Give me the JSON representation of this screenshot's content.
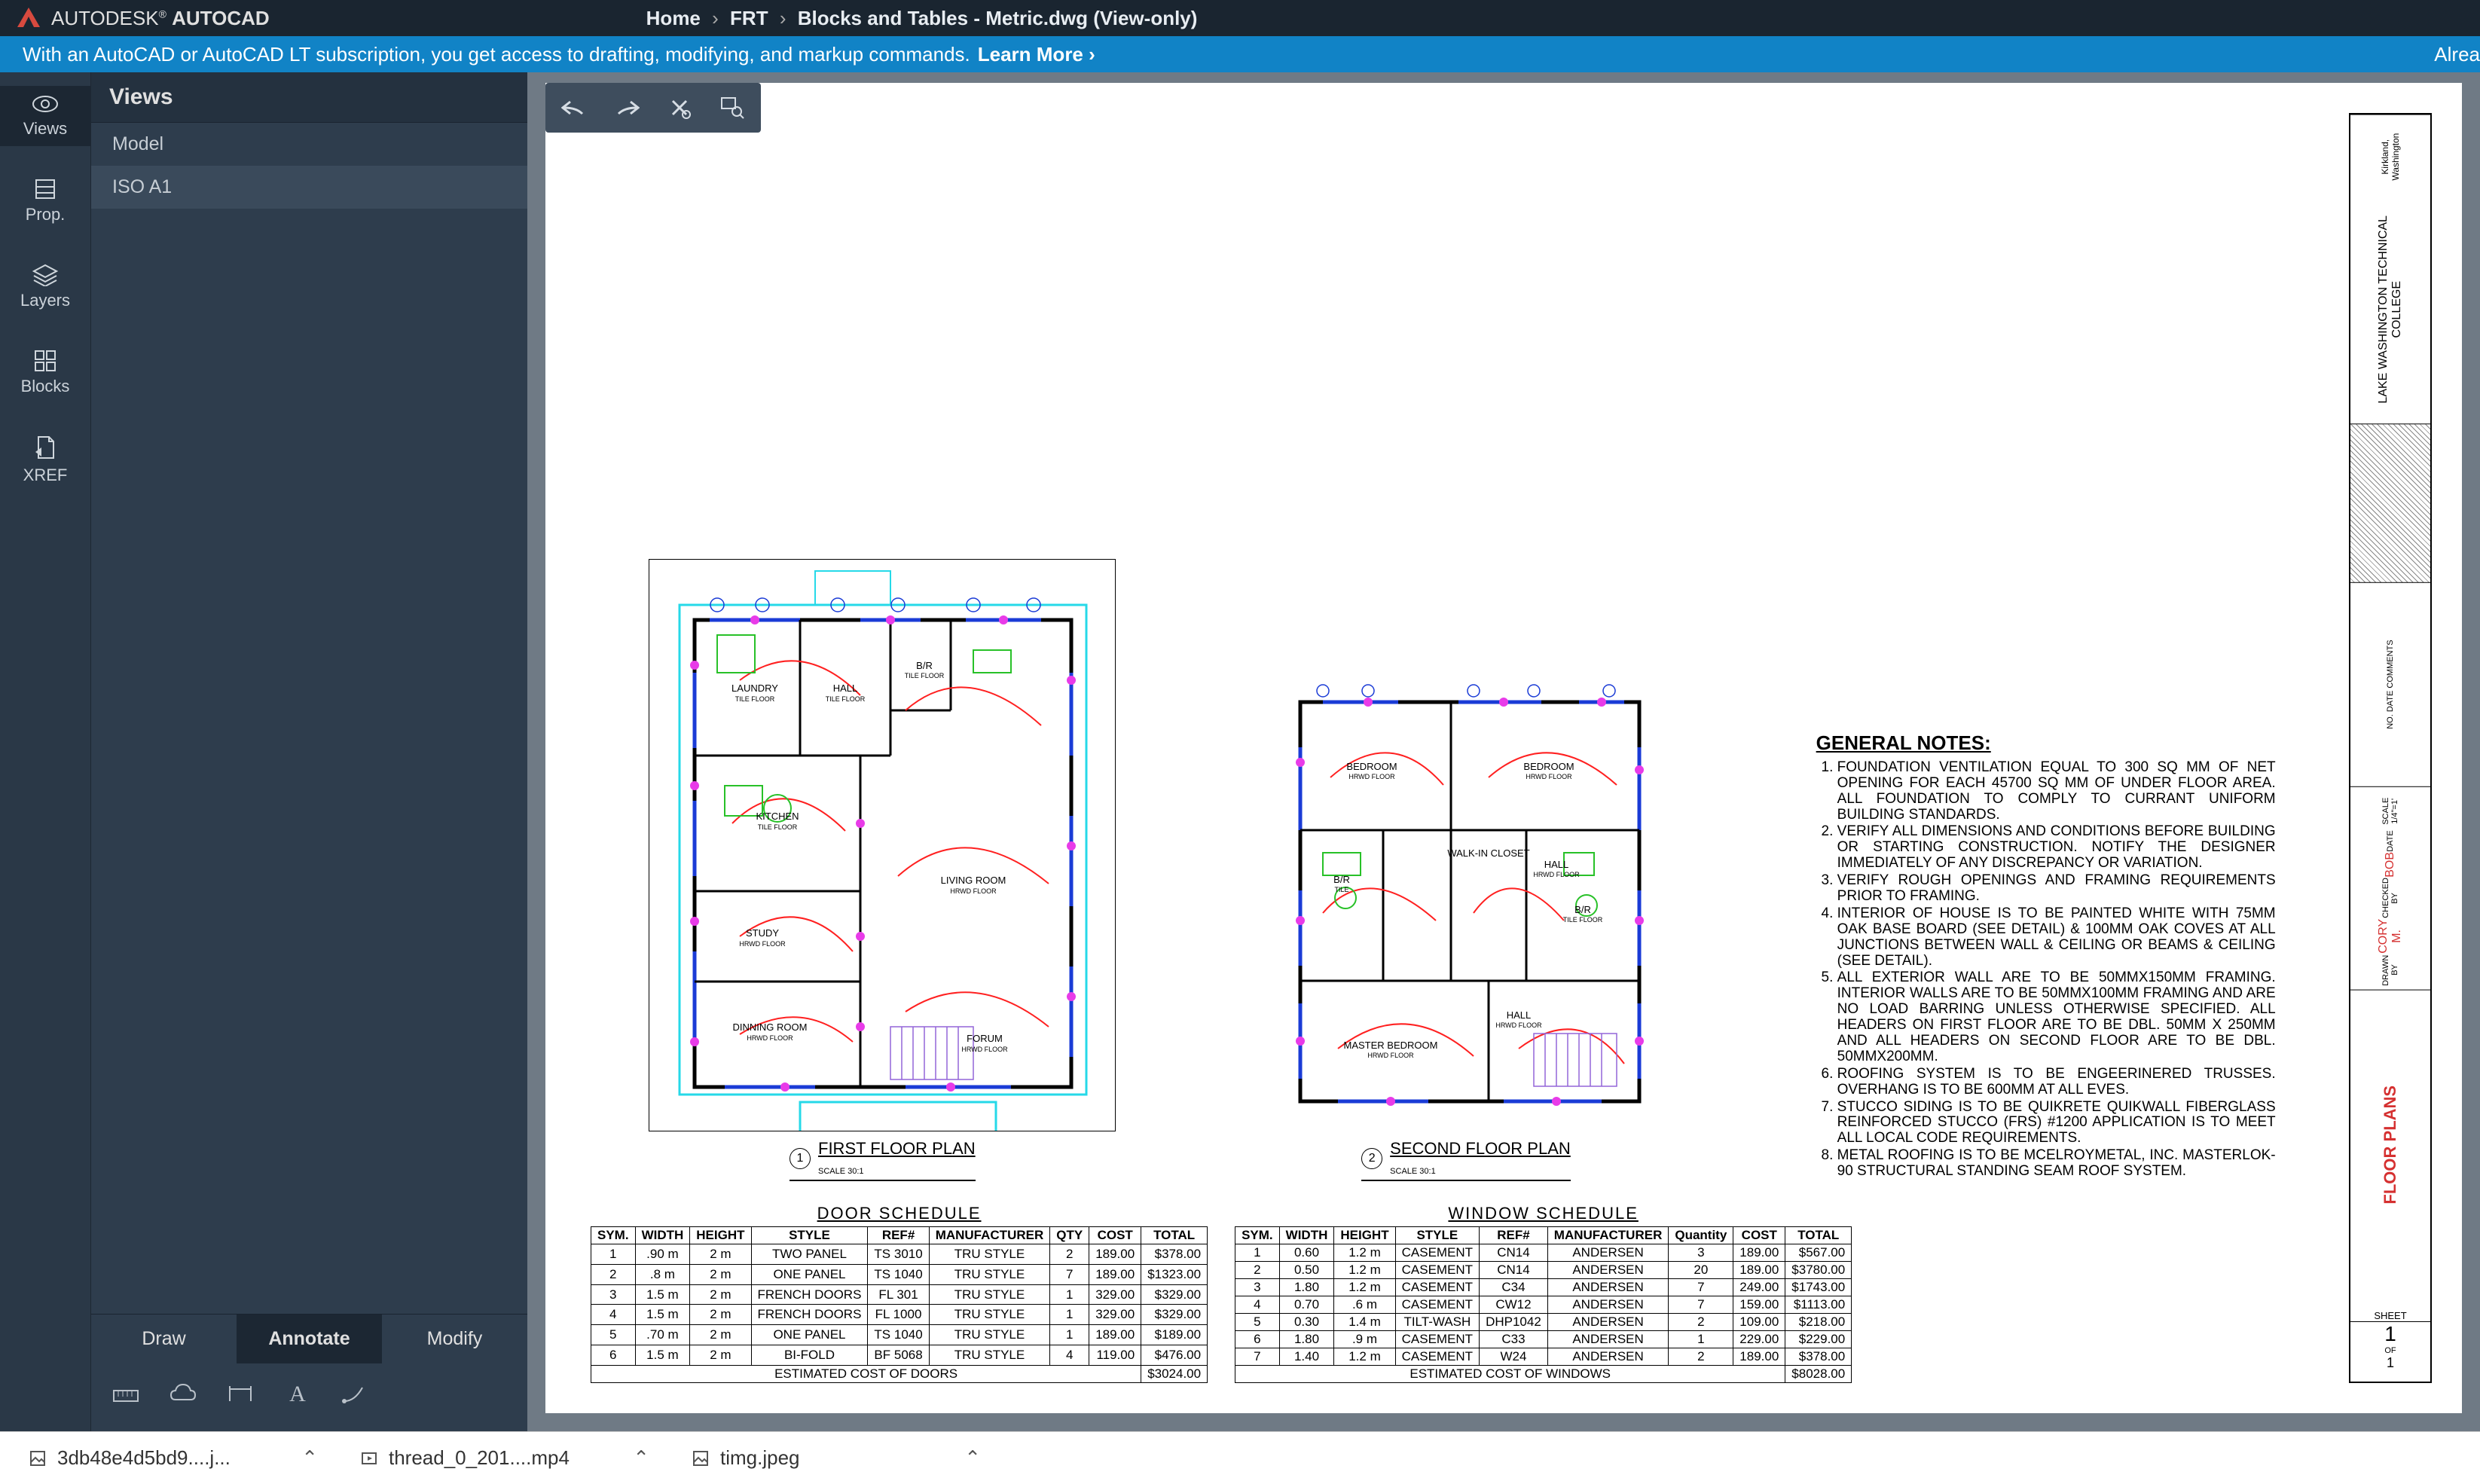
{
  "app": {
    "brand_a": "AUTODESK",
    "brand_b": "AUTOCAD",
    "breadcrumb": [
      "Home",
      "FRT",
      "Blocks and Tables - Metric.dwg (View-only)"
    ]
  },
  "announcement": {
    "text": "With an AutoCAD or AutoCAD LT subscription, you get access to drafting, modifying, and markup commands.",
    "link": "Learn More ›",
    "already": "Alrea"
  },
  "rail": [
    {
      "label": "Views",
      "active": true
    },
    {
      "label": "Prop.",
      "active": false
    },
    {
      "label": "Layers",
      "active": false
    },
    {
      "label": "Blocks",
      "active": false
    },
    {
      "label": "XREF",
      "active": false
    }
  ],
  "panel": {
    "title": "Views",
    "items": [
      "Model",
      "ISO A1"
    ],
    "selected": 1
  },
  "tool_tabs": [
    {
      "label": "Draw",
      "active": false
    },
    {
      "label": "Annotate",
      "active": true
    },
    {
      "label": "Modify",
      "active": false
    }
  ],
  "floor1": {
    "title": "FIRST FLOOR PLAN",
    "scale": "SCALE 30:1",
    "num": "1",
    "rooms": [
      "LAUNDRY",
      "HALL",
      "B/R",
      "KITCHEN",
      "LIVING ROOM",
      "STUDY",
      "DINNING ROOM",
      "FORUM"
    ],
    "floor": "HRWD FLOOR",
    "tile": "TILE FLOOR"
  },
  "floor2": {
    "title": "SECOND FLOOR PLAN",
    "scale": "SCALE 30:1",
    "num": "2",
    "rooms": [
      "BEDROOM",
      "BEDROOM",
      "WALK-IN CLOSET",
      "HALL",
      "B/R",
      "B/R",
      "MASTER BEDROOM",
      "HALL"
    ],
    "floor": "HRWD FLOOR"
  },
  "notes": {
    "title": "GENERAL NOTES:",
    "items": [
      "FOUNDATION VENTILATION EQUAL TO 300 SQ MM OF NET OPENING FOR EACH 45700 SQ MM OF UNDER FLOOR AREA. ALL FOUNDATION TO COMPLY TO CURRANT UNIFORM BUILDING STANDARDS.",
      "VERIFY ALL DIMENSIONS AND CONDITIONS BEFORE BUILDING OR STARTING CONSTRUCTION. NOTIFY THE DESIGNER IMMEDIATELY OF ANY DISCREPANCY OR VARIATION.",
      "VERIFY ROUGH OPENINGS AND FRAMING REQUIREMENTS PRIOR TO FRAMING.",
      "INTERIOR OF HOUSE IS TO BE PAINTED WHITE WITH 75MM OAK BASE BOARD (SEE DETAIL) & 100MM OAK COVES AT ALL JUNCTIONS BETWEEN WALL & CEILING OR BEAMS & CEILING (SEE DETAIL).",
      "ALL EXTERIOR WALL ARE TO BE 50MMX150MM FRAMING. INTERIOR WALLS ARE TO BE 50MMX100MM FRAMING AND ARE NO LOAD BARRING UNLESS OTHERWISE SPECIFIED. ALL HEADERS ON FIRST FLOOR ARE TO BE DBL. 50MM X 250MM AND ALL HEADERS ON SECOND FLOOR ARE TO BE DBL. 50MMX200MM.",
      "ROOFING SYSTEM IS TO BE ENGEERINERED TRUSSES. OVERHANG IS TO BE 600MM AT ALL EVES.",
      "STUCCO SIDING IS TO BE QUIKRETE QUIKWALL FIBERGLASS REINFORCED STUCCO (FRS) #1200 APPLICATION IS TO MEET ALL LOCAL CODE REQUIREMENTS.",
      "METAL ROOFING IS TO BE MCELROYMETAL, INC. MASTERLOK-90 STRUCTURAL STANDING SEAM ROOF SYSTEM."
    ]
  },
  "door_schedule": {
    "title": "DOOR SCHEDULE",
    "headers": [
      "SYM.",
      "WIDTH",
      "HEIGHT",
      "STYLE",
      "REF#",
      "MANUFACTURER",
      "QTY",
      "COST",
      "TOTAL"
    ],
    "rows": [
      [
        "1",
        ".90 m",
        "2 m",
        "TWO PANEL",
        "TS 3010",
        "TRU STYLE",
        "2",
        "189.00",
        "$378.00"
      ],
      [
        "2",
        ".8 m",
        "2 m",
        "ONE PANEL",
        "TS 1040",
        "TRU STYLE",
        "7",
        "189.00",
        "$1323.00"
      ],
      [
        "3",
        "1.5 m",
        "2 m",
        "FRENCH DOORS",
        "FL 301",
        "TRU STYLE",
        "1",
        "329.00",
        "$329.00"
      ],
      [
        "4",
        "1.5 m",
        "2 m",
        "FRENCH DOORS",
        "FL 1000",
        "TRU STYLE",
        "1",
        "329.00",
        "$329.00"
      ],
      [
        "5",
        ".70 m",
        "2 m",
        "ONE PANEL",
        "TS 1040",
        "TRU STYLE",
        "1",
        "189.00",
        "$189.00"
      ],
      [
        "6",
        "1.5 m",
        "2 m",
        "BI-FOLD",
        "BF 5068",
        "TRU STYLE",
        "4",
        "119.00",
        "$476.00"
      ]
    ],
    "est_label": "ESTIMATED COST OF DOORS",
    "est_total": "$3024.00"
  },
  "window_schedule": {
    "title": "WINDOW SCHEDULE",
    "headers": [
      "SYM.",
      "WIDTH",
      "HEIGHT",
      "STYLE",
      "REF#",
      "MANUFACTURER",
      "Quantity",
      "COST",
      "TOTAL"
    ],
    "rows": [
      [
        "1",
        "0.60",
        "1.2 m",
        "CASEMENT",
        "CN14",
        "ANDERSEN",
        "3",
        "189.00",
        "$567.00"
      ],
      [
        "2",
        "0.50",
        "1.2 m",
        "CASEMENT",
        "CN14",
        "ANDERSEN",
        "20",
        "189.00",
        "$3780.00"
      ],
      [
        "3",
        "1.80",
        "1.2 m",
        "CASEMENT",
        "C34",
        "ANDERSEN",
        "7",
        "249.00",
        "$1743.00"
      ],
      [
        "4",
        "0.70",
        ".6 m",
        "CASEMENT",
        "CW12",
        "ANDERSEN",
        "7",
        "159.00",
        "$1113.00"
      ],
      [
        "5",
        "0.30",
        "1.4 m",
        "TILT-WASH",
        "DHP1042",
        "ANDERSEN",
        "2",
        "109.00",
        "$218.00"
      ],
      [
        "6",
        "1.80",
        ".9 m",
        "CASEMENT",
        "C33",
        "ANDERSEN",
        "1",
        "229.00",
        "$229.00"
      ],
      [
        "7",
        "1.40",
        "1.2 m",
        "CASEMENT",
        "W24",
        "ANDERSEN",
        "2",
        "189.00",
        "$378.00"
      ]
    ],
    "est_label": "ESTIMATED COST OF WINDOWS",
    "est_total": "$8028.00"
  },
  "title_block": {
    "college": "LAKE WASHINGTON TECHNICAL COLLEGE",
    "location": "Kirkland, Washington",
    "drawn_label": "DRAWN BY",
    "drawn": "CORY M.",
    "checked_label": "CHECKED BY",
    "checked": "BOB",
    "date_label": "DATE",
    "scale_label": "SCALE 1/4\"=1'",
    "revisions": "NO. DATE COMMENTS",
    "plan_name": "FLOOR PLANS",
    "sheet_label": "SHEET",
    "sheet_num": "1",
    "sheet_of": "OF",
    "sheet_total": "1"
  },
  "taskbar": [
    {
      "name": "3db48e4d5bd9....j..."
    },
    {
      "name": "thread_0_201....mp4"
    },
    {
      "name": "timg.jpeg"
    }
  ]
}
